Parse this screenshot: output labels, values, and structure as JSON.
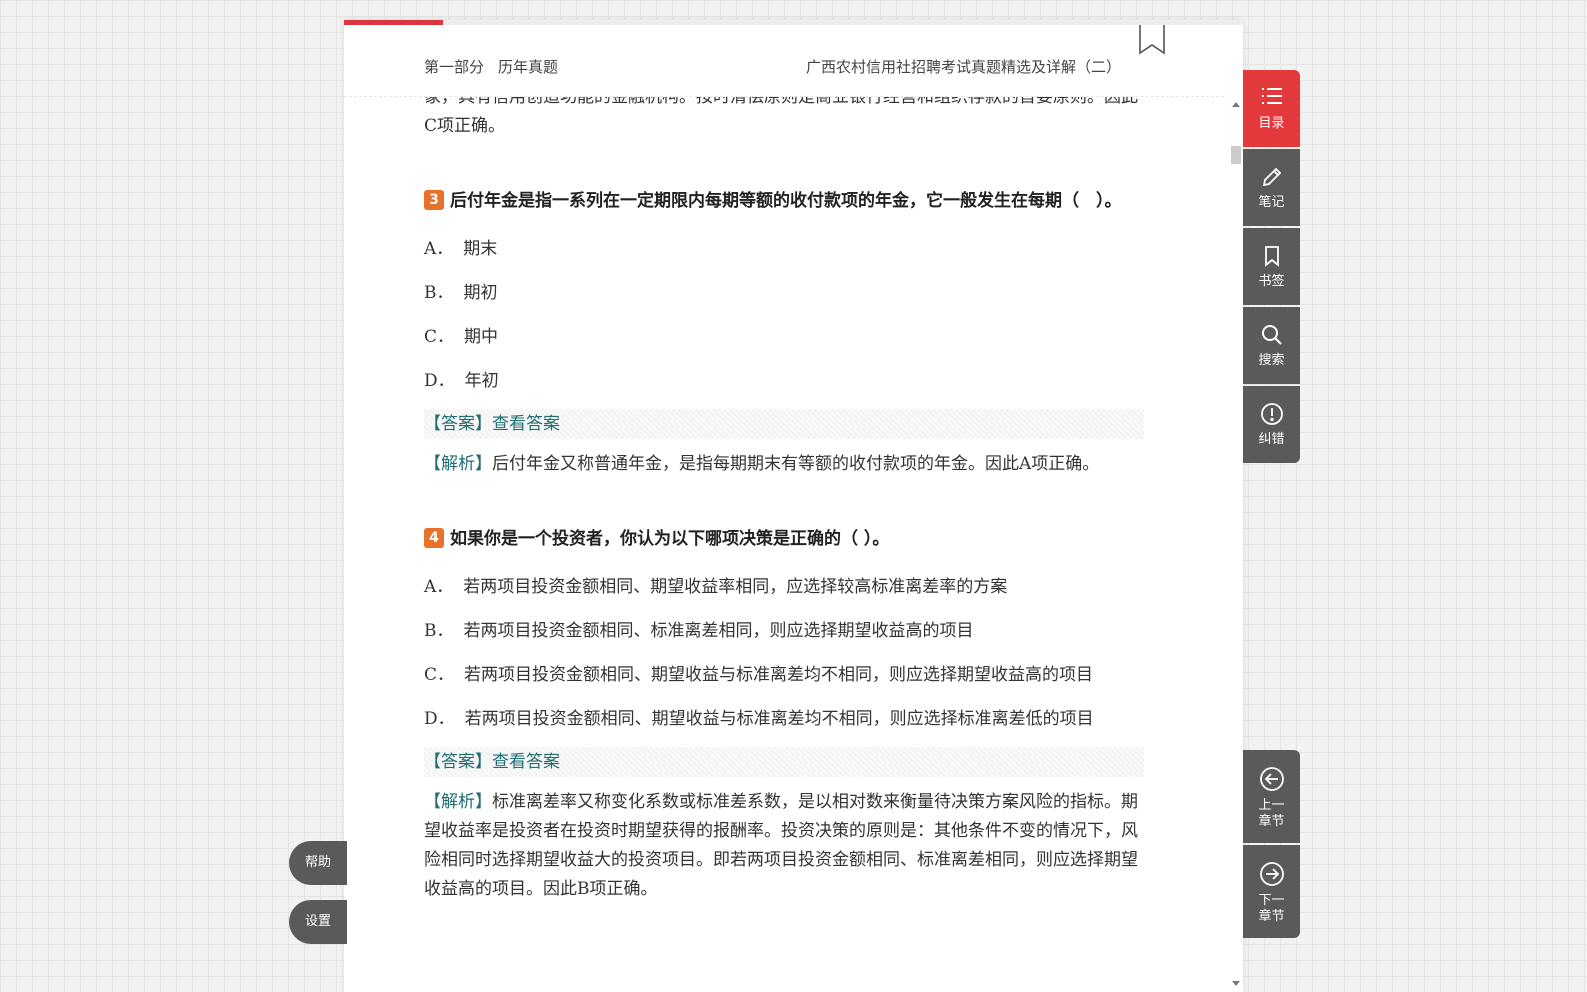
{
  "header": {
    "part": "第一部分",
    "section": "历年真题",
    "book_title": "广西农村信用社招聘考试真题精选及详解（二）"
  },
  "reading_progress": 0.11,
  "content": {
    "prev_tail": "象，具有信用创造功能的金融机构。按时清偿原则是商业银行经营和组织存款的首要原则。因此C项正确。",
    "questions": [
      {
        "number": "3",
        "stem": "后付年金是指一系列在一定期限内每期等额的收付款项的年金，它一般发生在每期（　）。",
        "options": [
          {
            "letter": "A．",
            "text": "期末"
          },
          {
            "letter": "B．",
            "text": "期初"
          },
          {
            "letter": "C．",
            "text": "期中"
          },
          {
            "letter": "D．",
            "text": "年初"
          }
        ],
        "answer_tag": "【答案】",
        "answer_link": "查看答案",
        "analysis_tag": "【解析】",
        "analysis": "后付年金又称普通年金，是指每期期末有等额的收付款项的年金。因此A项正确。"
      },
      {
        "number": "4",
        "stem": "如果你是一个投资者，你认为以下哪项决策是正确的（ ）。",
        "options": [
          {
            "letter": "A．",
            "text": "若两项目投资金额相同、期望收益率相同，应选择较高标准离差率的方案"
          },
          {
            "letter": "B．",
            "text": "若两项目投资金额相同、标准离差相同，则应选择期望收益高的项目"
          },
          {
            "letter": "C．",
            "text": "若两项目投资金额相同、期望收益与标准离差均不相同，则应选择期望收益高的项目"
          },
          {
            "letter": "D．",
            "text": "若两项目投资金额相同、期望收益与标准离差均不相同，则应选择标准离差低的项目"
          }
        ],
        "answer_tag": "【答案】",
        "answer_link": "查看答案",
        "analysis_tag": "【解析】",
        "analysis": "标准离差率又称变化系数或标准差系数，是以相对数来衡量待决策方案风险的指标。期望收益率是投资者在投资时期望获得的报酬率。投资决策的原则是：其他条件不变的情况下，风险相同时选择期望收益大的投资项目。即若两项目投资金额相同、标准离差相同，则应选择期望收益高的项目。因此B项正确。"
      }
    ]
  },
  "toolbar": {
    "items": [
      {
        "label": "目录",
        "icon": "list-icon",
        "active": true
      },
      {
        "label": "笔记",
        "icon": "pencil-icon"
      },
      {
        "label": "书签",
        "icon": "bookmark-icon"
      },
      {
        "label": "搜索",
        "icon": "search-icon"
      },
      {
        "label": "纠错",
        "icon": "alert-icon"
      }
    ]
  },
  "chapter_nav": {
    "prev_line1": "上一",
    "prev_line2": "章节",
    "next_line1": "下一",
    "next_line2": "章节"
  },
  "left_buttons": {
    "help": "帮助",
    "settings": "设置"
  },
  "colors": {
    "accent": "#e4393c",
    "qnum": "#e8722a",
    "tag": "#1f6e72",
    "toolbar": "#5a5a5a"
  }
}
